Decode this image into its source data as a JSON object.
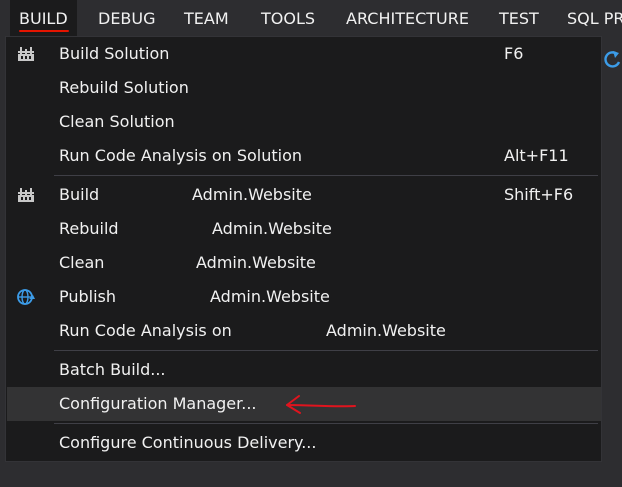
{
  "menubar": {
    "items": [
      "BUILD",
      "DEBUG",
      "TEAM",
      "TOOLS",
      "ARCHITECTURE",
      "TEST",
      "SQL PR"
    ]
  },
  "menu": {
    "build_solution": {
      "label": "Build Solution",
      "shortcut": "F6",
      "icon": "build-icon"
    },
    "rebuild_solution": {
      "label": "Rebuild Solution"
    },
    "clean_solution": {
      "label": "Clean Solution"
    },
    "code_analysis_solution": {
      "label": "Run Code Analysis on Solution",
      "shortcut": "Alt+F11"
    },
    "build": {
      "label": "Build",
      "target": "Admin.Website",
      "shortcut": "Shift+F6",
      "icon": "build-icon"
    },
    "rebuild": {
      "label": "Rebuild",
      "target": "Admin.Website"
    },
    "clean": {
      "label": "Clean",
      "target": "Admin.Website"
    },
    "publish": {
      "label": "Publish",
      "target": "Admin.Website",
      "icon": "globe-publish-icon"
    },
    "code_analysis": {
      "label": "Run Code Analysis on",
      "target": "Admin.Website"
    },
    "batch_build": {
      "label": "Batch Build..."
    },
    "configuration_manager": {
      "label": "Configuration Manager..."
    },
    "continuous_delivery": {
      "label": "Configure Continuous Delivery..."
    }
  },
  "colors": {
    "accent_underline": "#e51400",
    "annotation_arrow": "#e0141e",
    "menu_background": "#1b1b1c",
    "menubar_background": "#2d2d30",
    "highlight": "#333334",
    "publish_icon": "#3c9ce8"
  }
}
